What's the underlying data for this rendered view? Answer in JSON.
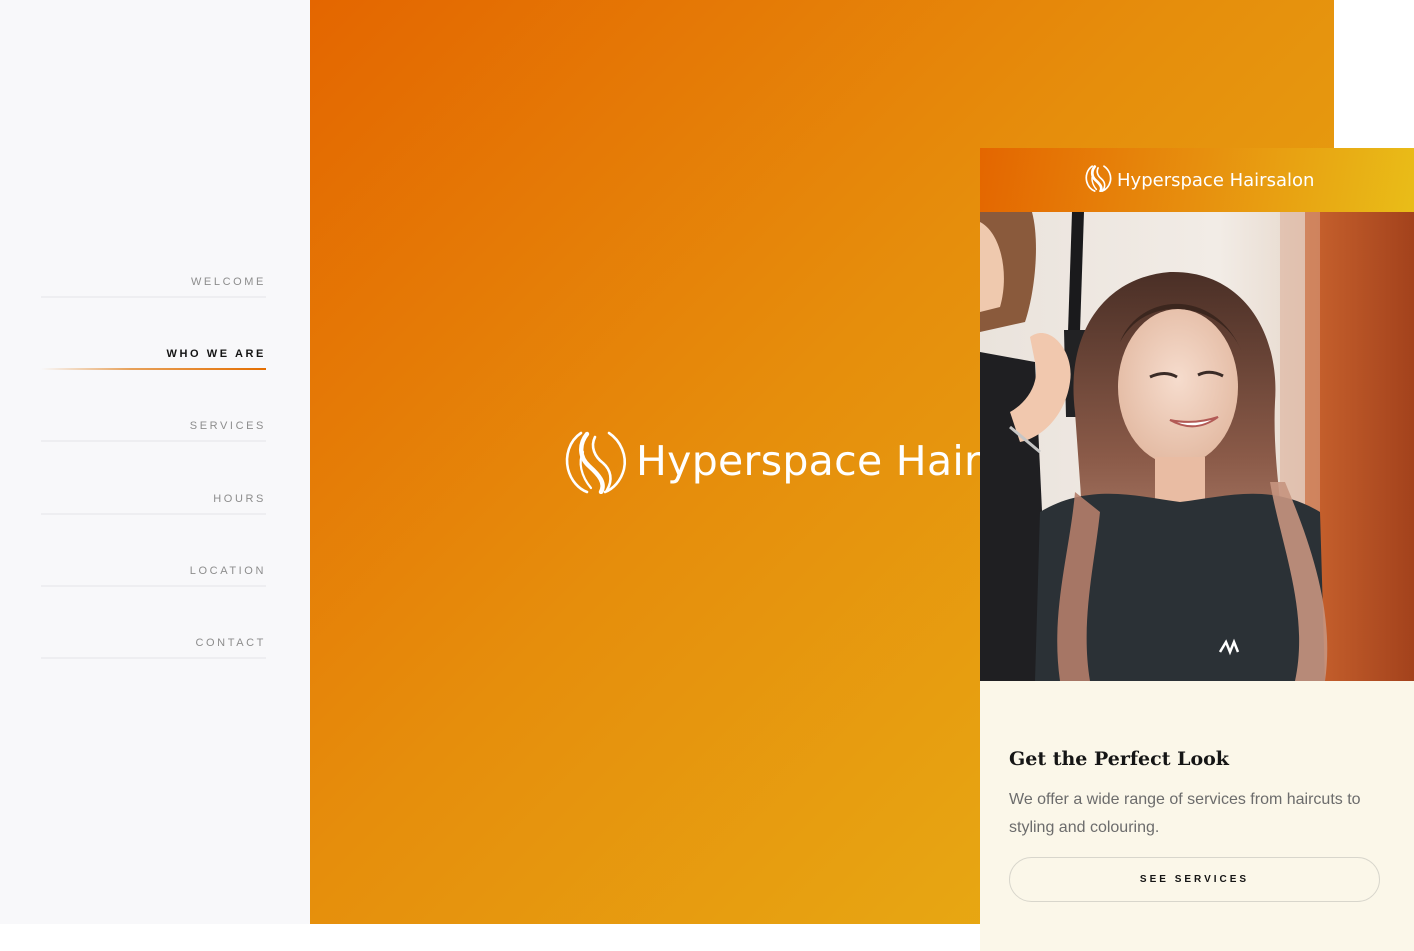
{
  "sidebar": {
    "items": [
      {
        "label": "WELCOME",
        "active": false
      },
      {
        "label": "WHO WE ARE",
        "active": true
      },
      {
        "label": "SERVICES",
        "active": false
      },
      {
        "label": "HOURS",
        "active": false
      },
      {
        "label": "LOCATION",
        "active": false
      },
      {
        "label": "CONTACT",
        "active": false
      }
    ]
  },
  "hero": {
    "brand_name": "Hyperspace Hairsalon",
    "logo_icon": "hair-swirl-logo-icon"
  },
  "mobile": {
    "header": {
      "brand_name": "Hyperspace Hairsalon",
      "logo_icon": "hair-swirl-logo-icon"
    },
    "card": {
      "title": "Get the Perfect Look",
      "text": "We offer a wide range of services from haircuts to styling and colouring.",
      "button_label": "SEE SERVICES"
    }
  },
  "colors": {
    "gradient_start": "#e46600",
    "gradient_end": "#e9bd18",
    "sidebar_bg": "#f8f8fa",
    "mobile_card_bg": "#fbf7e9"
  }
}
